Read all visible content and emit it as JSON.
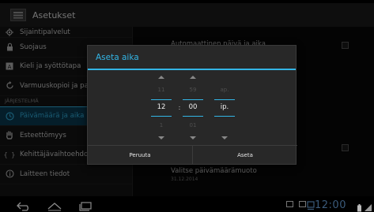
{
  "actionbar": {
    "title": "Asetukset"
  },
  "sidebar": {
    "items": [
      {
        "label": "Sijaintipalvelut",
        "icon": "location-icon"
      },
      {
        "label": "Suojaus",
        "icon": "lock-icon"
      },
      {
        "label": "Kieli ja syöttötapa",
        "icon": "keyboard-icon"
      },
      {
        "label": "Varmuuskopioi ja palauta",
        "icon": "backup-icon"
      }
    ],
    "section_header": "JÄRJESTELMÄ",
    "system_items": [
      {
        "label": "Päivämäärä ja aika",
        "icon": "clock-icon",
        "active": true
      },
      {
        "label": "Esteettömyys",
        "icon": "hand-icon"
      },
      {
        "label": "Kehittäjävaihtoehdot",
        "icon": "braces-icon"
      },
      {
        "label": "Laitteen tiedot",
        "icon": "info-icon"
      }
    ]
  },
  "content": {
    "auto_datetime": {
      "title": "Automaattinen päivä ja aika"
    },
    "date_format": {
      "title": "Valitse päivämäärämuoto",
      "subtitle": "31.12.2014"
    }
  },
  "dialog": {
    "title": "Aseta aika",
    "hour": {
      "prev": "11",
      "current": "12",
      "next": "1"
    },
    "minute": {
      "prev": "59",
      "current": "00",
      "next": "01"
    },
    "ampm": {
      "prev": "ap.",
      "current": "ip."
    },
    "separator": ":",
    "cancel_label": "Peruuta",
    "set_label": "Aseta"
  },
  "statusbar": {
    "clock": "12:00",
    "clock_color": "#3a5a7a"
  },
  "colors": {
    "accent": "#33b5e5"
  }
}
